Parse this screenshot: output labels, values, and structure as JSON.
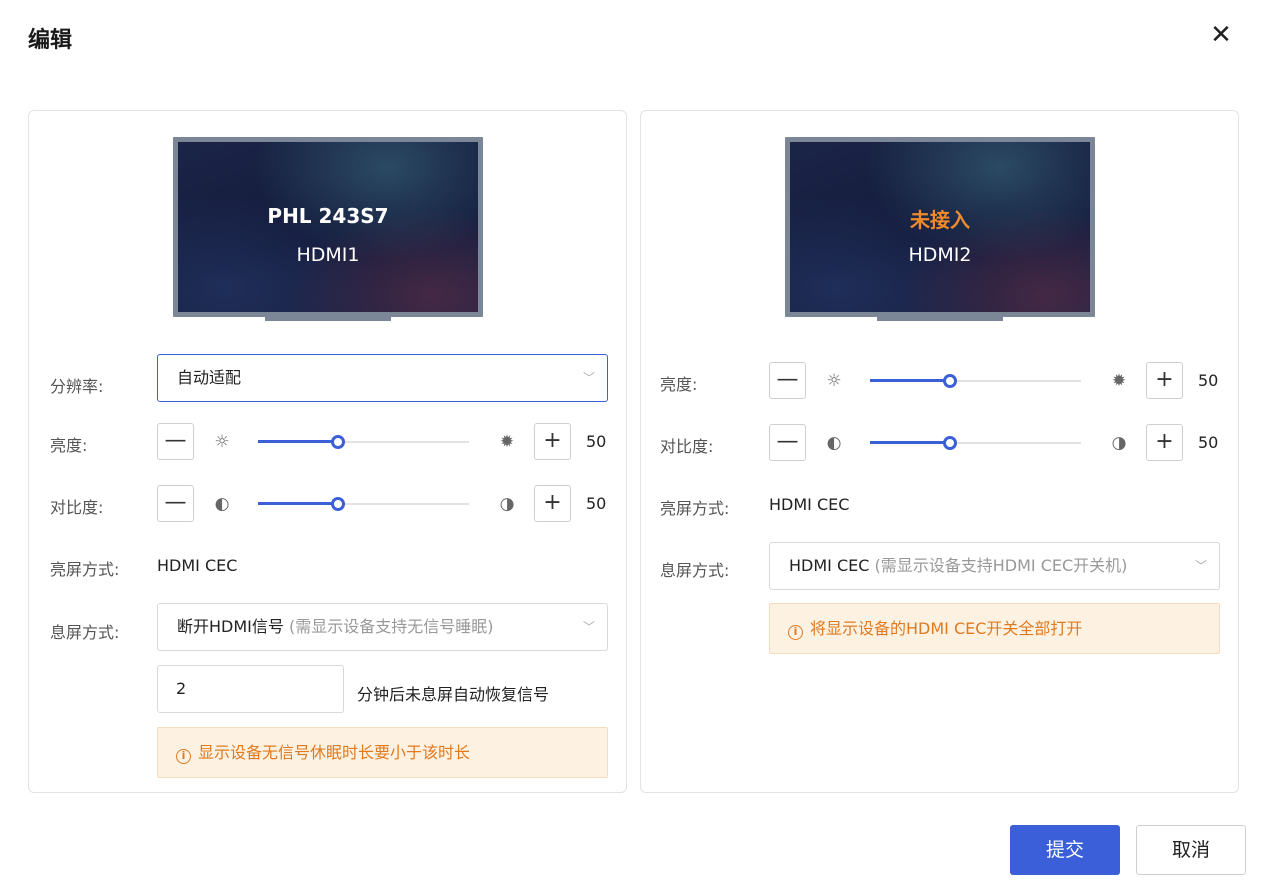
{
  "dialog": {
    "title": "编辑",
    "close_icon": "close-icon"
  },
  "left": {
    "monitor": {
      "name": "PHL 243S7",
      "port": "HDMI1"
    },
    "resolution": {
      "label": "分辨率:",
      "value": "自动适配"
    },
    "brightness": {
      "label": "亮度:",
      "value": 50,
      "percent": 38,
      "minus": "—",
      "plus": "+"
    },
    "contrast": {
      "label": "对比度:",
      "value": 50,
      "percent": 38,
      "minus": "—",
      "plus": "+"
    },
    "screen_on": {
      "label": "亮屏方式:",
      "value": "HDMI CEC"
    },
    "screen_off": {
      "label": "息屏方式:",
      "value": "断开HDMI信号",
      "hint": "(需显示设备支持无信号睡眠)"
    },
    "minutes": {
      "value": "2",
      "suffix": "分钟后未息屏自动恢复信号"
    },
    "warning": "显示设备无信号休眠时长要小于该时长"
  },
  "right": {
    "monitor": {
      "name": "未接入",
      "port": "HDMI2"
    },
    "brightness": {
      "label": "亮度:",
      "value": 50,
      "percent": 38,
      "minus": "—",
      "plus": "+"
    },
    "contrast": {
      "label": "对比度:",
      "value": 50,
      "percent": 38,
      "minus": "—",
      "plus": "+"
    },
    "screen_on": {
      "label": "亮屏方式:",
      "value": "HDMI CEC"
    },
    "screen_off": {
      "label": "息屏方式:",
      "value": "HDMI CEC",
      "hint": "(需显示设备支持HDMI CEC开关机)"
    },
    "warning": "将显示设备的HDMI CEC开关全部打开"
  },
  "footer": {
    "submit": "提交",
    "cancel": "取消"
  },
  "colors": {
    "accent": "#3a5fd9",
    "warning": "#e07a1f",
    "warning_bg": "#fdf1e2"
  }
}
